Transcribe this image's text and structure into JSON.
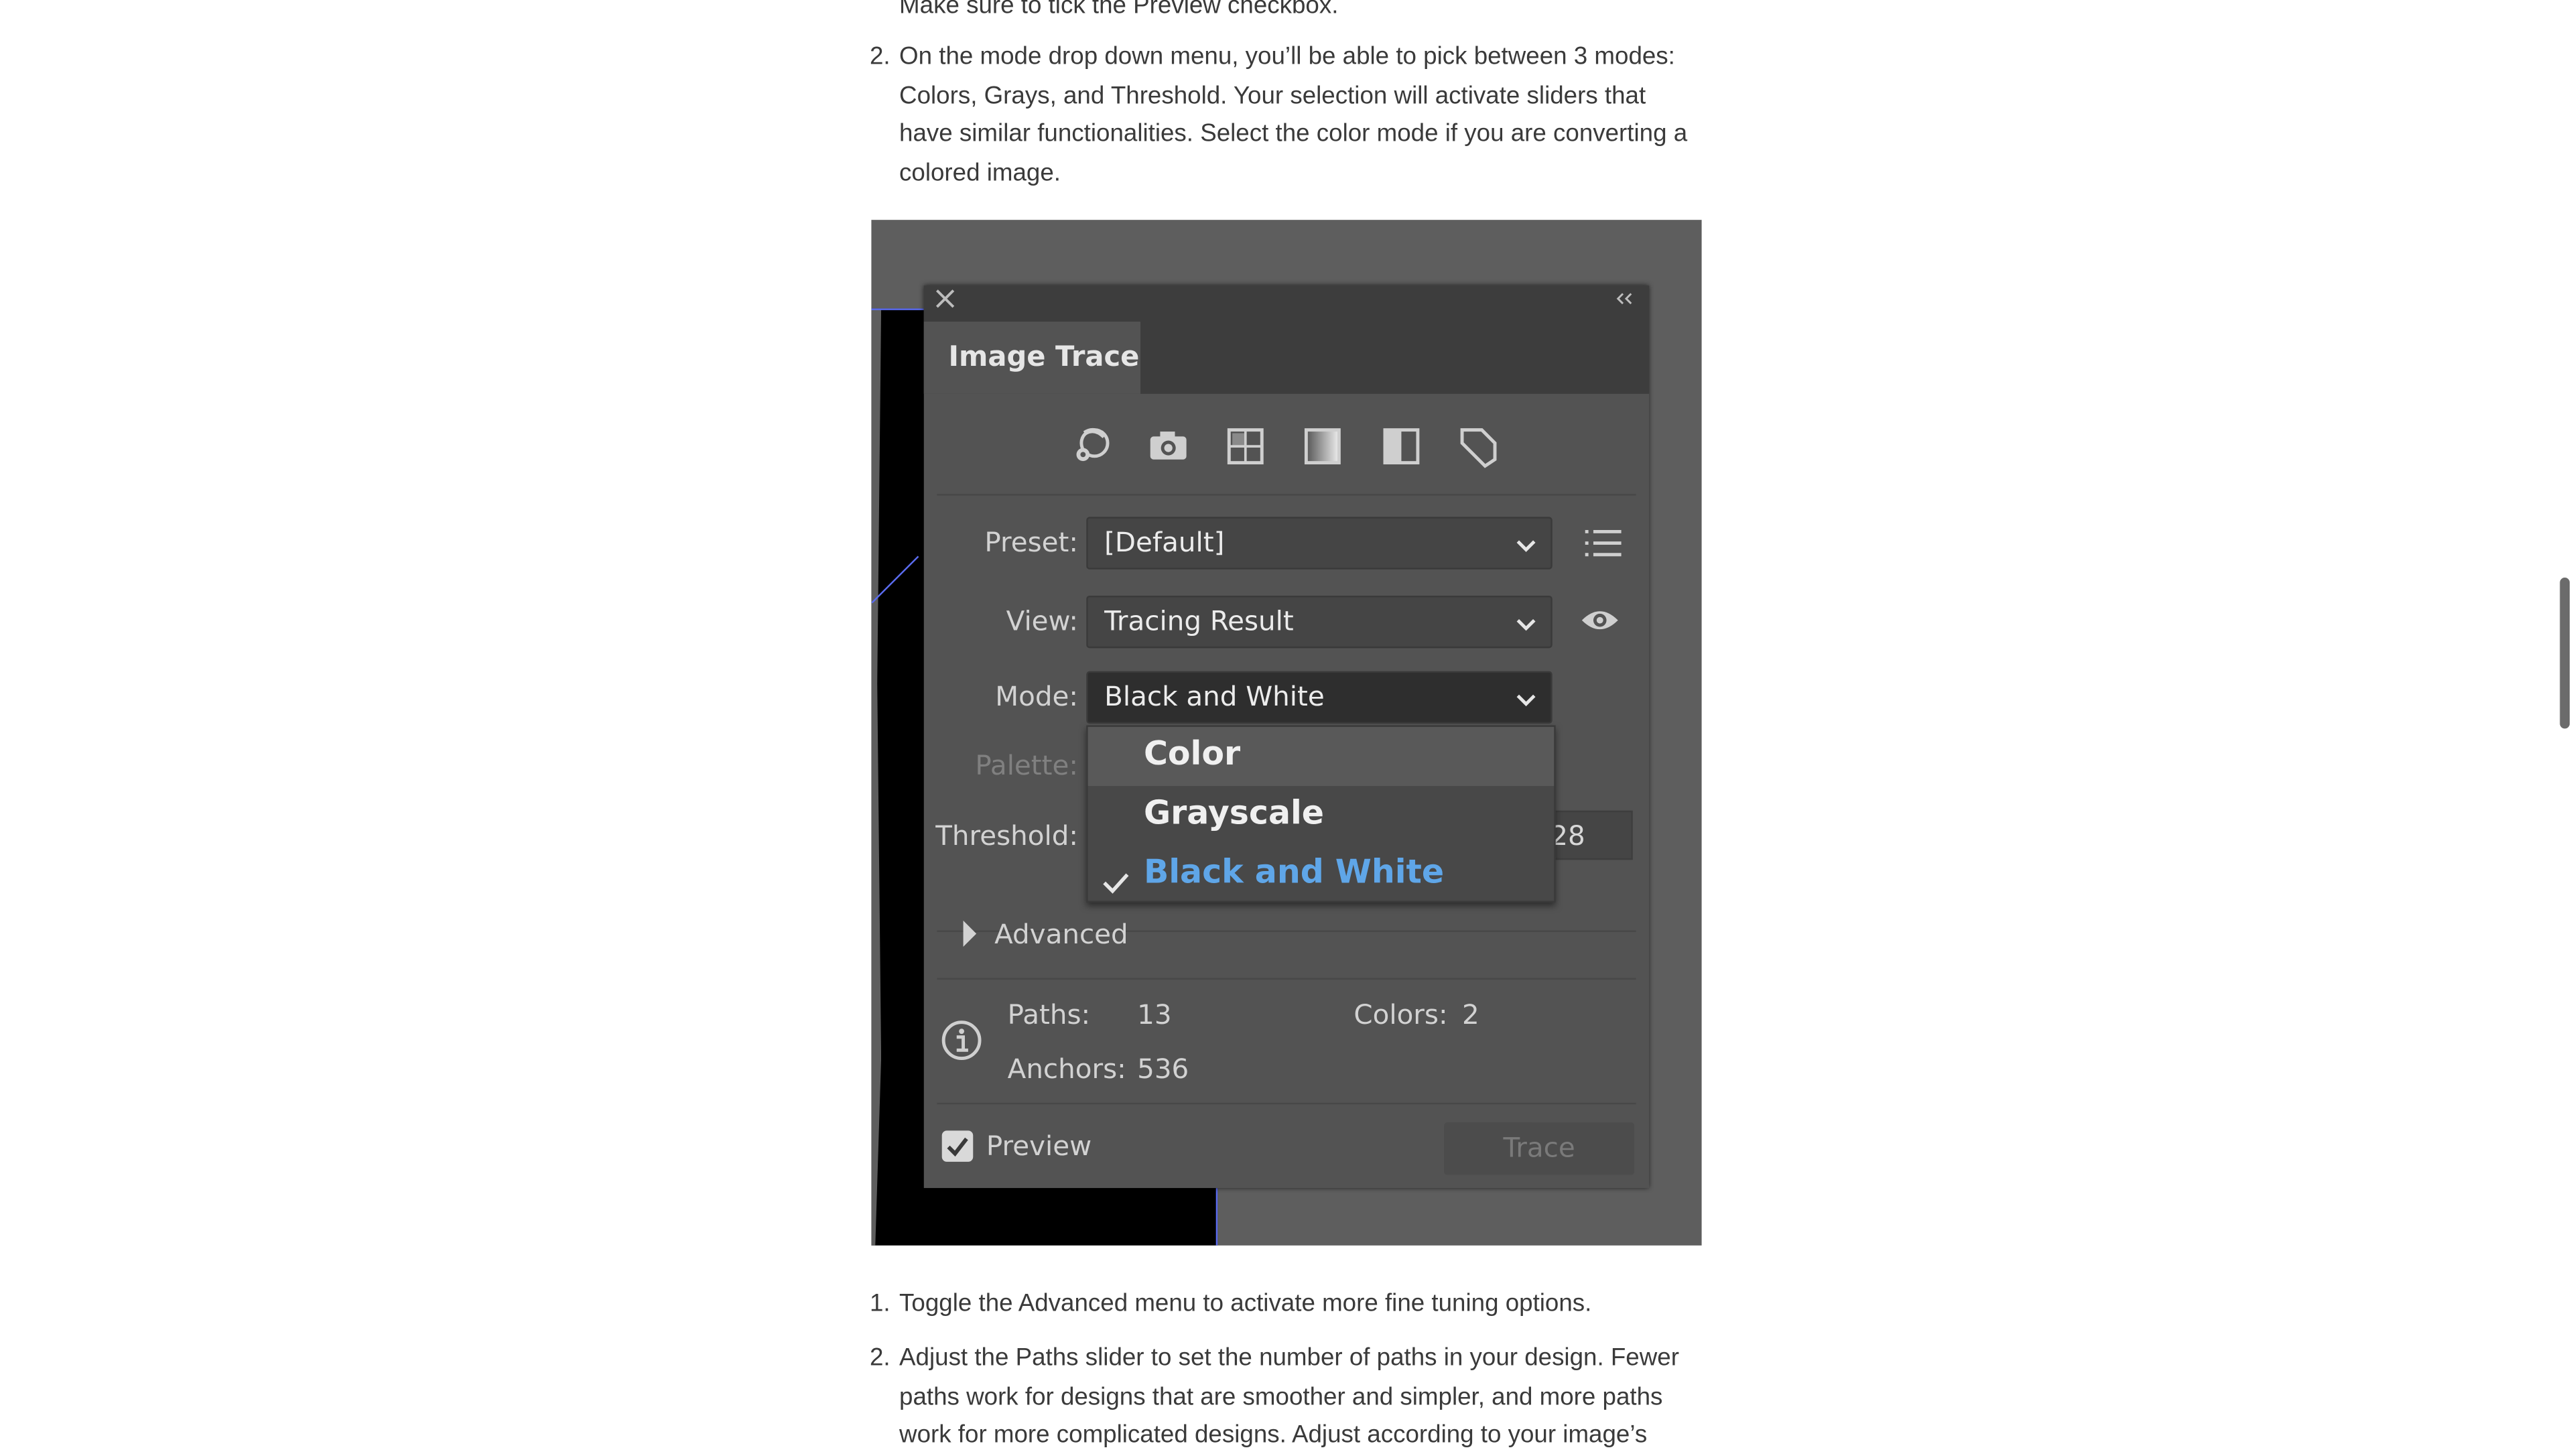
{
  "article": {
    "cut_top": "Make sure to tick the Preview checkbox.",
    "item2_num": "2.",
    "item2_text": "On the mode drop down menu, you’ll be able to pick between 3 modes: Colors, Grays, and Threshold. Your selection will activate sliders that have similar functionalities. Select the color mode if you are converting a colored image.",
    "item3_num": "1.",
    "item3_text": "Toggle the Advanced menu to activate more fine tuning options.",
    "item4_num": "2.",
    "item4_text": "Adjust the Paths slider to set the number of paths in your design. Fewer paths work for designs that are smoother and simpler, and more paths work for more complicated designs. Adjust according to your image’s"
  },
  "panel": {
    "title": "Image Trace",
    "close_icon": "close-icon",
    "collapse_icon": "double-chevron-icon",
    "preset_icons": [
      "auto-color-icon",
      "high-color-icon",
      "low-color-icon",
      "grayscale-icon",
      "black-white-icon",
      "outline-icon"
    ],
    "preset_label": "Preset:",
    "preset_value": "[Default]",
    "view_label": "View:",
    "view_value": "Tracing Result",
    "mode_label": "Mode:",
    "mode_value": "Black and White",
    "palette_label": "Palette:",
    "threshold_label": "Threshold:",
    "threshold_value_partial": "28",
    "mode_options": [
      "Color",
      "Grayscale",
      "Black and White"
    ],
    "mode_selected": "Black and White",
    "advanced_label": "Advanced",
    "paths_label": "Paths:",
    "paths_value": "13",
    "colors_label": "Colors:",
    "colors_value": "2",
    "anchors_label": "Anchors:",
    "anchors_value": "536",
    "preview_label": "Preview",
    "preview_checked": true,
    "trace_label": "Trace"
  },
  "colors": {
    "panel_bg": "#535353",
    "header_bg": "#3d3d3d",
    "menu_selected": "#5fa6e8",
    "guide_line": "#5b6cf0"
  }
}
